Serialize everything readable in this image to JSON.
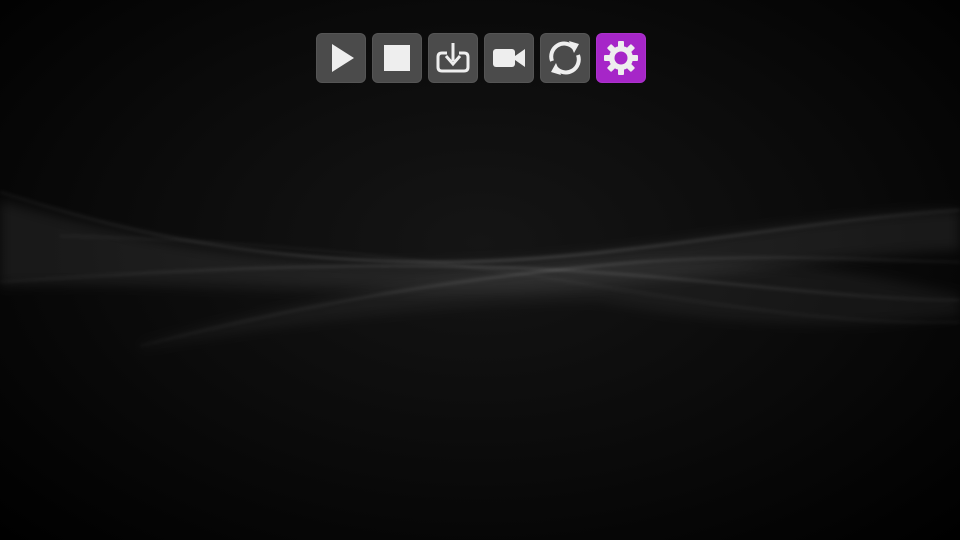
{
  "toolbar": {
    "buttons": [
      {
        "id": "play",
        "icon": "play-icon",
        "selected": false
      },
      {
        "id": "stop",
        "icon": "stop-icon",
        "selected": false
      },
      {
        "id": "download",
        "icon": "download-tray-icon",
        "selected": false
      },
      {
        "id": "record",
        "icon": "video-camera-icon",
        "selected": false
      },
      {
        "id": "refresh",
        "icon": "refresh-icon",
        "selected": false
      },
      {
        "id": "settings",
        "icon": "gear-icon",
        "selected": true
      }
    ]
  },
  "colors": {
    "background": "#000000",
    "button": "#4b4b4b",
    "selected": "#a626c8",
    "icon": "#eeeeee",
    "wave": "#ffffff"
  }
}
